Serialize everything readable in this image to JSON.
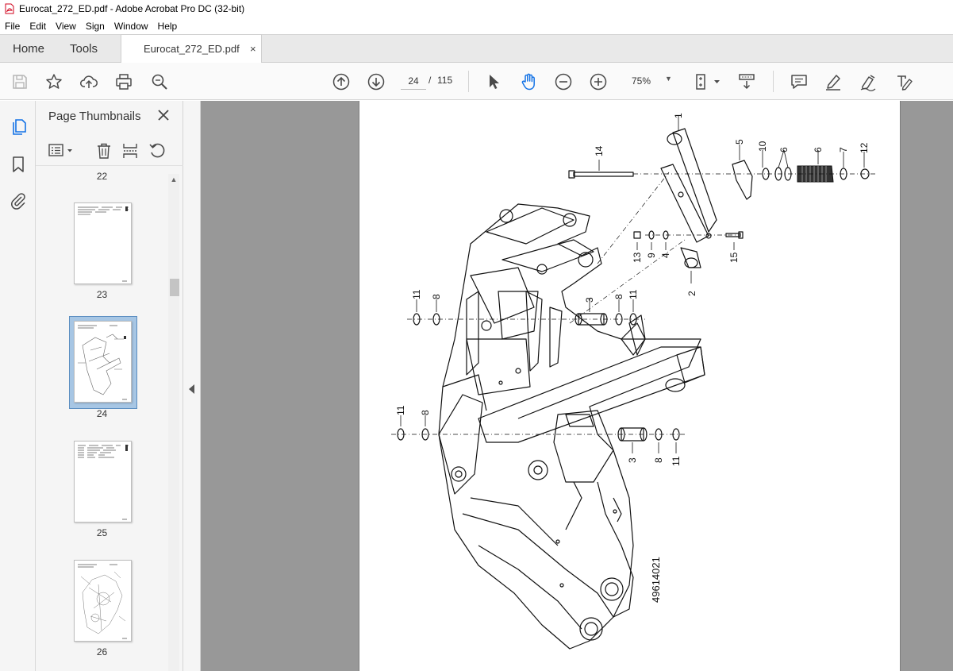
{
  "window": {
    "title": "Eurocat_272_ED.pdf - Adobe Acrobat Pro DC (32-bit)",
    "app_icon": "acrobat-pdf-icon"
  },
  "menu": [
    "File",
    "Edit",
    "View",
    "Sign",
    "Window",
    "Help"
  ],
  "tabs": {
    "home": "Home",
    "tools": "Tools",
    "document": "Eurocat_272_ED.pdf",
    "document_close": "×"
  },
  "toolbar": {
    "left_icons": [
      "save-icon",
      "bookmark-star-icon",
      "upload-cloud-icon",
      "print-icon",
      "find-zoom-icon"
    ],
    "nav_icons": [
      "prev-page-icon",
      "next-page-icon"
    ],
    "current_page": "24",
    "page_separator": "/",
    "total_pages": "115",
    "tool_icons": [
      "select-cursor-icon",
      "hand-tool-icon",
      "zoom-out-icon",
      "zoom-in-icon"
    ],
    "zoom": "75%",
    "right_icons": [
      "fit-page-icon",
      "scroll-mode-icon",
      "comment-icon",
      "highlight-icon",
      "sign-pen-icon",
      "edit-text-icon"
    ],
    "accent_color": "#1473e6"
  },
  "left_rail": [
    "page-thumbnails-icon",
    "bookmarks-icon",
    "attachments-icon"
  ],
  "thumbnails_panel": {
    "title": "Page Thumbnails",
    "close": "×",
    "tools": [
      "thumbnail-options-icon",
      "delete-page-icon",
      "extract-page-icon",
      "rotate-page-icon"
    ],
    "pages": [
      {
        "label": "22",
        "selected": false
      },
      {
        "label": "23",
        "selected": false
      },
      {
        "label": "24",
        "selected": true
      },
      {
        "label": "25",
        "selected": false
      },
      {
        "label": "26",
        "selected": false
      }
    ],
    "selection_color": "#a7c6e4"
  },
  "document": {
    "drawing_number": "49614021",
    "part_labels": [
      "1",
      "2",
      "3",
      "3",
      "4",
      "5",
      "6",
      "6",
      "7",
      "8",
      "8",
      "8",
      "8",
      "9",
      "10",
      "11",
      "11",
      "11",
      "11",
      "12",
      "13",
      "14",
      "15"
    ]
  }
}
